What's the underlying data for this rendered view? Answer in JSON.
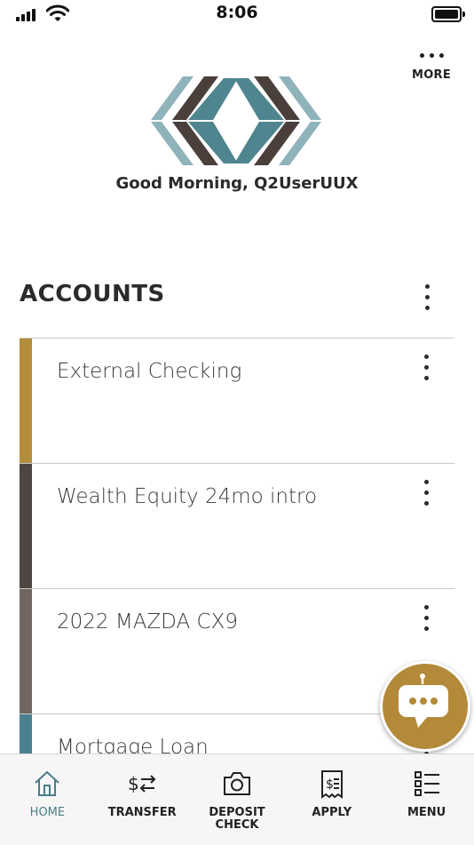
{
  "status": {
    "time": "8:06"
  },
  "header": {
    "more_label": "MORE",
    "greeting": "Good Morning, Q2UserUUX"
  },
  "accounts": {
    "title": "ACCOUNTS",
    "items": [
      {
        "name": "External Checking",
        "color": "#b38d3c"
      },
      {
        "name": "Wealth Equity 24mo intro",
        "color": "#4f4542"
      },
      {
        "name": "2022 MAZDA CX9",
        "color": "#726760"
      },
      {
        "name": "Mortgage Loan",
        "color": "#4a8090"
      }
    ]
  },
  "tabs": [
    {
      "label": "HOME",
      "icon": "home-icon",
      "active": true
    },
    {
      "label": "TRANSFER",
      "icon": "transfer-icon"
    },
    {
      "label": "DEPOSIT\nCHECK",
      "icon": "camera-icon"
    },
    {
      "label": "APPLY",
      "icon": "document-dollar-icon"
    },
    {
      "label": "MENU",
      "icon": "list-icon"
    }
  ],
  "colors": {
    "accent_teal": "#4a7d86",
    "accent_gold": "#b38a3a",
    "logo_dark": "#4a3f3b",
    "logo_light": "#8eb3bb"
  }
}
